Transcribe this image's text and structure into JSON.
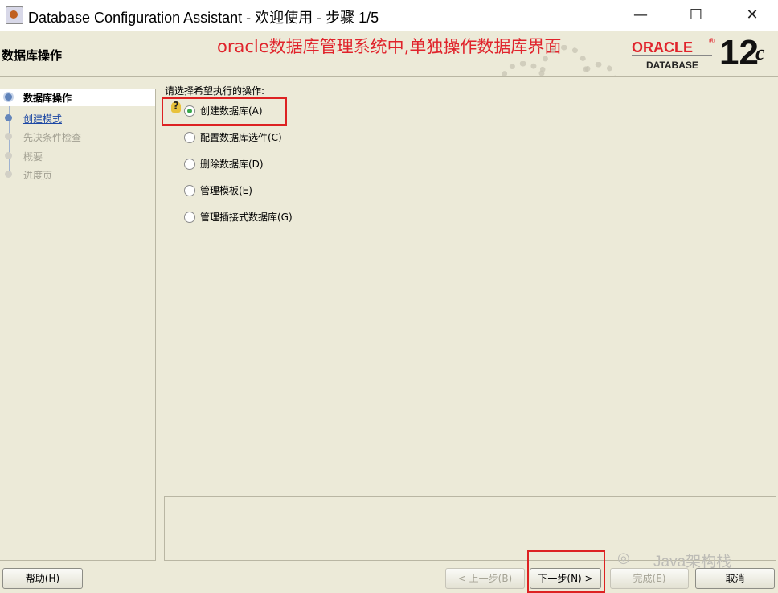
{
  "window": {
    "title": "Database Configuration Assistant - 欢迎使用 - 步骤 1/5",
    "minimize_symbol": "—",
    "maximize_symbol": "☐",
    "close_symbol": "✕"
  },
  "header": {
    "page_title": "数据库操作",
    "annotation": "oracle数据库管理系统中,单独操作数据库界面",
    "logo": {
      "brand": "ORACLE",
      "registered": "®",
      "product": "DATABASE",
      "version": "12",
      "version_suffix": "c"
    }
  },
  "sidebar": {
    "steps": [
      {
        "label": "数据库操作",
        "state": "active"
      },
      {
        "label": "创建模式",
        "state": "link"
      },
      {
        "label": "先决条件检查",
        "state": "disabled"
      },
      {
        "label": "概要",
        "state": "disabled"
      },
      {
        "label": "进度页",
        "state": "disabled"
      }
    ]
  },
  "main": {
    "question": "请选择希望执行的操作:",
    "options": [
      {
        "label": "创建数据库(A)",
        "checked": true
      },
      {
        "label": "配置数据库选件(C)",
        "checked": false
      },
      {
        "label": "删除数据库(D)",
        "checked": false
      },
      {
        "label": "管理模板(E)",
        "checked": false
      },
      {
        "label": "管理插接式数据库(G)",
        "checked": false
      }
    ]
  },
  "buttons": {
    "help": "帮助(H)",
    "back": "< 上一步(B)",
    "next": "下一步(N) >",
    "finish": "完成(E)",
    "cancel": "取消"
  },
  "watermark": "Java架构栈",
  "colors": {
    "background": "#ecead8",
    "accent_red": "#e0232b",
    "selected_radio": "#39a84b",
    "link_blue": "#1d48a4"
  }
}
